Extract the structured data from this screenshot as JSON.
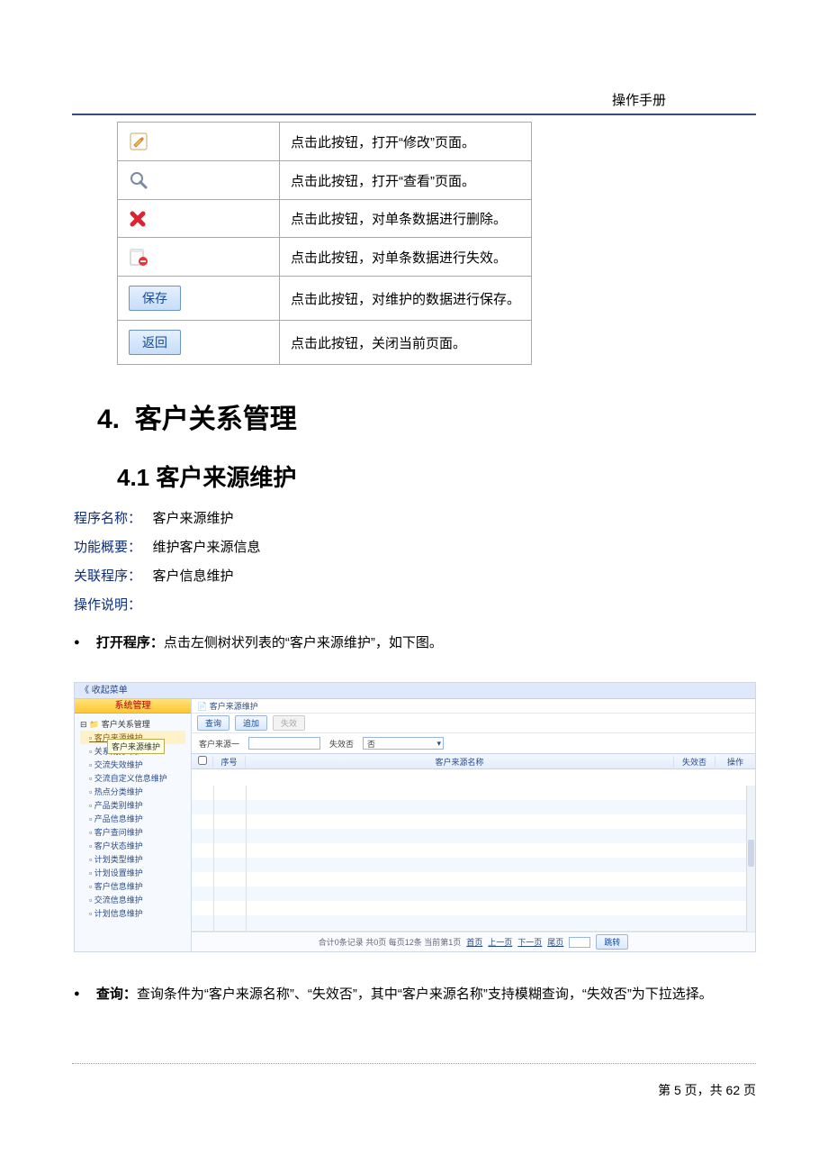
{
  "header": {
    "doc_title": "操作手册"
  },
  "icon_table": {
    "rows": [
      {
        "icon": "edit-icon",
        "desc": "点击此按钮，打开“修改”页面。"
      },
      {
        "icon": "view-icon",
        "desc": "点击此按钮，打开“查看”页面。"
      },
      {
        "icon": "delete-icon",
        "desc": "点击此按钮，对单条数据进行删除。"
      },
      {
        "icon": "invalid-icon",
        "desc": "点击此按钮，对单条数据进行失效。"
      },
      {
        "icon": "save-button",
        "label": "保存",
        "desc": "点击此按钮，对维护的数据进行保存。"
      },
      {
        "icon": "back-button",
        "label": "返回",
        "desc": "点击此按钮，关闭当前页面。"
      }
    ]
  },
  "headings": {
    "h1_num": "4.",
    "h1_text": "客户关系管理",
    "h2_num": "4.1",
    "h2_text": "客户来源维护"
  },
  "meta": {
    "program_label": "程序名称：",
    "program_value": "客户来源维护",
    "summary_label": "功能概要：",
    "summary_value": "维护客户来源信息",
    "related_label": "关联程序：",
    "related_value": "客户信息维护",
    "instr_label": "操作说明："
  },
  "bullets": {
    "open_label": "打开程序：",
    "open_text": "点击左侧树状列表的“客户来源维护”，如下图。",
    "query_label": "查询：",
    "query_text": "查询条件为“客户来源名称”、“失效否”，其中“客户来源名称”支持模糊查询，“失效否”为下拉选择。"
  },
  "screenshot": {
    "menu_toggle": "《 收起菜单",
    "breadcrumb_icon": "📄",
    "breadcrumb": "客户来源维护",
    "sidebar_title": "系统管理",
    "tree_root": "客户关系管理",
    "tree": [
      "客户来源维护",
      "关系划分维护",
      "交流失效维护",
      "交流自定义信息维护",
      "热点分类维护",
      "产品类别维护",
      "产品信息维护",
      "客户查问维护",
      "客户状态维护",
      "计划类型维护",
      "计划设置维护",
      "客户信息维护",
      "交流信息维护",
      "计划信息维护"
    ],
    "tree_tooltip": "客户来源维护",
    "toolbar": {
      "query": "查询",
      "add": "追加",
      "invalid": "失效"
    },
    "filter": {
      "name_label": "客户来源一",
      "invalid_label": "失效否",
      "invalid_value": "否"
    },
    "grid": {
      "col_seq": "序号",
      "col_name": "客户来源名称",
      "col_invalid": "失效否",
      "col_op": "操作"
    },
    "pager": {
      "summary": "合计0条记录  共0页 每页12条 当前第1页",
      "first": "首页",
      "prev": "上一页",
      "next": "下一页",
      "last": "尾页",
      "jump": "跳转"
    }
  },
  "footer": {
    "prefix": "第 ",
    "page": "5",
    "mid": " 页，共 ",
    "total": "62",
    "suffix": " 页"
  }
}
